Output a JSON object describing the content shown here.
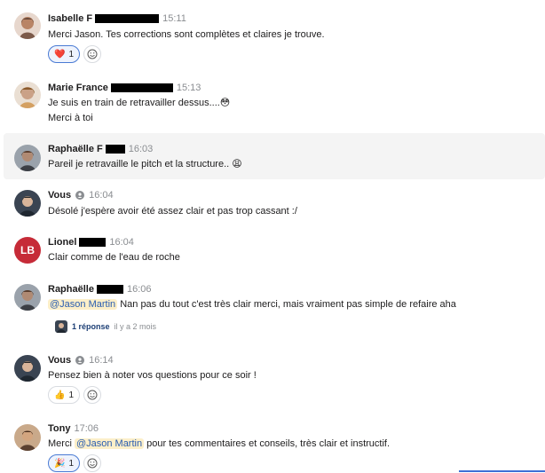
{
  "messages": [
    {
      "id": "m1",
      "author": "Isabelle F",
      "time": "15:11",
      "text": "Merci Jason. Tes corrections sont complètes et claires je trouve.",
      "reaction": {
        "emoji": "❤️",
        "count": "1"
      }
    },
    {
      "id": "m2",
      "author": "Marie France",
      "time": "15:13",
      "lines": [
        "Je suis en train de retravailler dessus....😳",
        "Merci à toi"
      ]
    },
    {
      "id": "m3",
      "author": "Raphaëlle F",
      "time": "16:03",
      "text": "Pareil je retravaille le pitch et la structure.. 😩"
    },
    {
      "id": "m4",
      "author": "Vous",
      "time": "16:04",
      "text": "Désolé j'espère avoir été assez clair et pas trop cassant :/"
    },
    {
      "id": "m5",
      "author": "Lionel",
      "initials": "LB",
      "time": "16:04",
      "text": "Clair comme de l'eau de roche"
    },
    {
      "id": "m6",
      "author": "Raphaëlle",
      "time": "16:06",
      "mention": "@Jason Martin",
      "text": "Nan pas du tout c'est très clair merci, mais vraiment pas simple de refaire aha",
      "thread": {
        "replies": "1 réponse",
        "ago": "il y a 2 mois"
      }
    },
    {
      "id": "m7",
      "author": "Vous",
      "time": "16:14",
      "text": "Pensez bien à noter vos questions pour ce soir !",
      "reaction": {
        "emoji": "👍",
        "count": "1"
      }
    },
    {
      "id": "m8",
      "author": "Tony",
      "time": "17:06",
      "prefix": "Merci",
      "mention": "@Jason Martin",
      "text": "pour tes commentaires et conseils, très clair et instructif.",
      "reaction": {
        "emoji": "🎉",
        "count": "1"
      }
    }
  ],
  "icons": {
    "add_reaction": "smiley-plus-icon",
    "status": "person-status-icon"
  },
  "colors": {
    "mention_bg": "#fcefc9",
    "mention_text": "#2a5db0",
    "lionel_avatar": "#c62b38",
    "thread_link": "#1d3f75"
  }
}
